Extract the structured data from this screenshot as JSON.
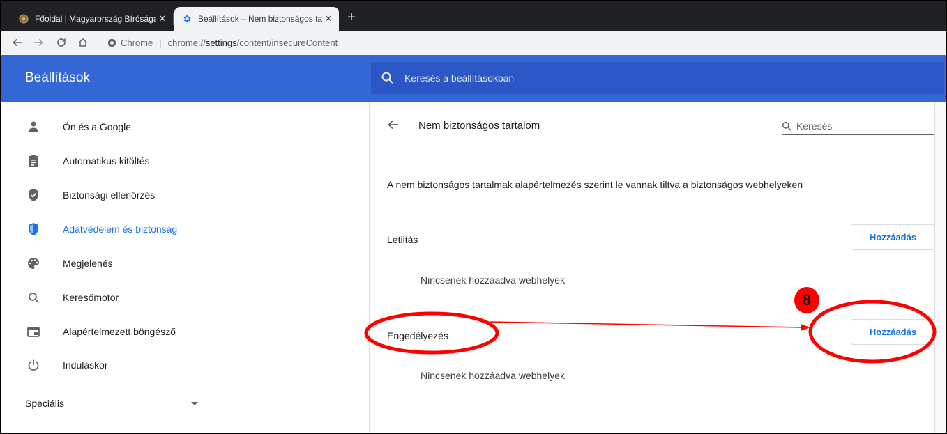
{
  "browser": {
    "tabs": [
      {
        "title": "Főoldal | Magyarország Bíróságai",
        "active": false
      },
      {
        "title": "Beállítások – Nem biztonságos ta",
        "active": true
      }
    ],
    "new_tab_symbol": "+",
    "omnibox": {
      "chip_label": "Chrome",
      "url_prefix": "chrome://",
      "url_host": "settings",
      "url_path": "/content/insecureContent"
    }
  },
  "settings": {
    "header_title": "Beállítások",
    "search_placeholder": "Keresés a beállításokban",
    "nav": [
      {
        "label": "Ön és a Google",
        "icon": "person-icon",
        "active": false
      },
      {
        "label": "Automatikus kitöltés",
        "icon": "clipboard-icon",
        "active": false
      },
      {
        "label": "Biztonsági ellenőrzés",
        "icon": "shield-check-icon",
        "active": false
      },
      {
        "label": "Adatvédelem és biztonság",
        "icon": "shield-icon",
        "active": true
      },
      {
        "label": "Megjelenés",
        "icon": "palette-icon",
        "active": false
      },
      {
        "label": "Keresőmotor",
        "icon": "search-icon",
        "active": false
      },
      {
        "label": "Alapértelmezett böngésző",
        "icon": "browser-icon",
        "active": false
      },
      {
        "label": "Induláskor",
        "icon": "power-icon",
        "active": false
      }
    ],
    "special_label": "Speciális"
  },
  "content": {
    "page_title": "Nem biztonságos tartalom",
    "search_label": "Keresés",
    "description": "A nem biztonságos tartalmak alapértelmezés szerint le vannak tiltva a biztonságos webhelyeken",
    "block_section": {
      "title": "Letiltás",
      "add_label": "Hozzáadás",
      "empty_text": "Nincsenek hozzáadva webhelyek"
    },
    "allow_section": {
      "title": "Engedélyezés",
      "add_label": "Hozzáadás",
      "empty_text": "Nincsenek hozzáadva webhelyek"
    }
  },
  "annotation": {
    "step_number": "8",
    "color": "#ff0000"
  },
  "colors": {
    "header_blue": "#3367d6",
    "search_bar_blue": "#2a56c6",
    "accent_blue": "#1a73e8",
    "tabstrip": "#202124"
  }
}
